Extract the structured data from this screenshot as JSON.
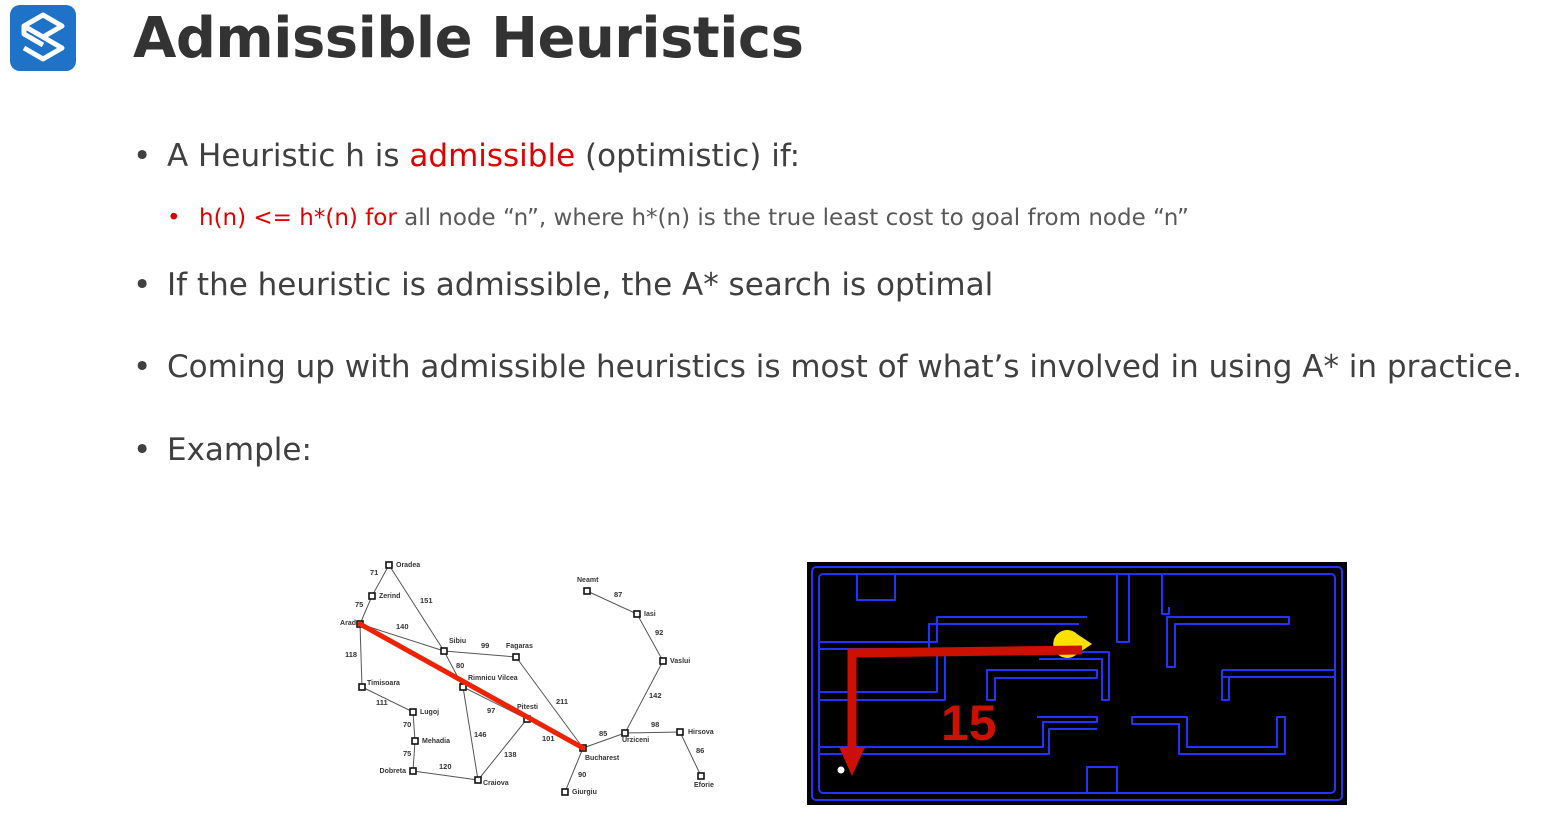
{
  "slide": {
    "title": "Admissible Heuristics"
  },
  "bullets": [
    {
      "pre": "A Heuristic h is ",
      "highlight": "admissible",
      "post": " (optimistic) if:"
    },
    {
      "text": "If the heuristic is admissible,  the A* search is optimal"
    },
    {
      "text": "Coming up with admissible heuristics is most of what’s involved in using A* in practice."
    },
    {
      "text": "Example:"
    }
  ],
  "sub_bullet": {
    "highlight": "h(n) <= h*(n) for",
    "rest": " all node “n”, where h*(n) is the true least cost to goal from node “n”"
  },
  "bullet_symbol": "•",
  "colors": {
    "accent_red": "#e00000",
    "logo_blue": "#1e73c8",
    "maze_wall": "#2233ff",
    "pacman": "#ffe000",
    "arrow": "#cc1100"
  },
  "romania_map": {
    "cities": [
      "Oradea",
      "Zerind",
      "Arad",
      "Timisoara",
      "Lugoj",
      "Mehadia",
      "Dobreta",
      "Sibiu",
      "Rimnicu Vilcea",
      "Fagaras",
      "Pitesti",
      "Craiova",
      "Bucharest",
      "Giurgiu",
      "Urziceni",
      "Hirsova",
      "Eforie",
      "Vaslui",
      "Iasi",
      "Neamt"
    ],
    "edge_costs": [
      "71",
      "75",
      "151",
      "140",
      "118",
      "111",
      "70",
      "75",
      "120",
      "99",
      "80",
      "97",
      "146",
      "138",
      "211",
      "101",
      "90",
      "85",
      "98",
      "86",
      "142",
      "92",
      "87"
    ]
  },
  "pacman_maze": {
    "distance_label": "15"
  }
}
